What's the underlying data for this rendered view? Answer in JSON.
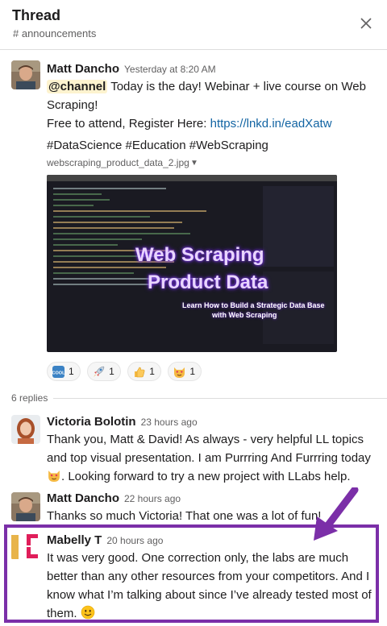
{
  "header": {
    "title": "Thread",
    "channel": "# announcements"
  },
  "message1": {
    "author": "Matt Dancho",
    "time": "Yesterday at 8:20 AM",
    "mention": "@channel",
    "line1": " Today is the day! Webinar + live course on Web",
    "line2": "Scraping!",
    "line3_prefix": "Free to attend, Register Here: ",
    "link": "https://lnkd.in/eadXatw",
    "hashtags": "#DataScience #Education #WebScraping",
    "filename": "webscraping_product_data_2.jpg",
    "image": {
      "title_line1": "Web Scraping",
      "title_line2": "Product Data",
      "subtitle_line1": "Learn How to Build a Strategic Data Base",
      "subtitle_line2": "with Web Scraping"
    },
    "reactions": [
      {
        "emoji": "cool-icon",
        "count": "1"
      },
      {
        "emoji": "rocket-icon",
        "count": "1"
      },
      {
        "emoji": "thumbsup-icon",
        "count": "1"
      },
      {
        "emoji": "heart-eyes-cat-icon",
        "count": "1"
      }
    ]
  },
  "replies_label": "6 replies",
  "message2": {
    "author": "Victoria Bolotin",
    "time": "23 hours ago",
    "line1": "Thank you, Matt & David! As always - very helpful LL topics",
    "line2": "and top visual presentation.  I am Purrring And Furrring  today",
    "line3": ". Looking forward to try a new project with LLabs help."
  },
  "message3": {
    "author": "Matt Dancho",
    "time": "22 hours ago",
    "line1": "Thanks so much Victoria! That one was a lot of fun!"
  },
  "message4": {
    "author": "Mabelly T",
    "time": "20 hours ago",
    "line1": "It was very good. One correction only, the labs are much",
    "line2": "better than any other resources from your competitors. And I",
    "line3": "know what I’m talking about since I’ve already tested most of",
    "line4": "them. "
  },
  "colors": {
    "link": "#1264a3",
    "highlight": "#7b2fa8",
    "mention_bg": "#fdf3cf"
  }
}
